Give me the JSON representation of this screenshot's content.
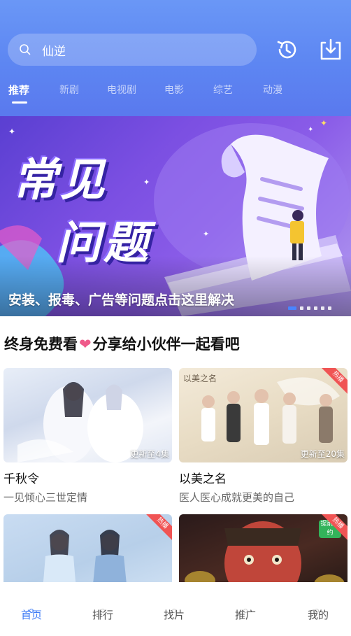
{
  "search": {
    "text": "仙逆"
  },
  "icons": {
    "search": "search-icon",
    "history": "history-icon",
    "download": "download-icon"
  },
  "tabs": [
    {
      "label": "推荐",
      "active": true
    },
    {
      "label": "新剧",
      "active": false
    },
    {
      "label": "电视剧",
      "active": false
    },
    {
      "label": "电影",
      "active": false
    },
    {
      "label": "综艺",
      "active": false
    },
    {
      "label": "动漫",
      "active": false
    }
  ],
  "banner": {
    "title_line1": "常见",
    "title_line2": "问题",
    "caption": "安装、报毒、广告等问题点击这里解决",
    "slide_count": 6,
    "active_slide": 1
  },
  "section": {
    "title_part1": "终身免费看",
    "heart": "❤",
    "title_part2": "分享给小伙伴一起看吧"
  },
  "cards": [
    {
      "name": "千秋令",
      "desc": "一见倾心三世定情",
      "badge": "更新至4集",
      "hot": ""
    },
    {
      "name": "以美之名",
      "desc": "医人医心成就更美的自己",
      "badge": "更新至20集",
      "hot": "热播",
      "poster_title": "以美之名"
    },
    {
      "name": "",
      "desc": "",
      "badge": "",
      "hot": "热播"
    },
    {
      "name": "",
      "desc": "",
      "badge": "",
      "hot": "热播",
      "tag": "提前预约"
    }
  ],
  "bottom_nav": [
    {
      "label": "首页",
      "active": true
    },
    {
      "label": "排行",
      "active": false
    },
    {
      "label": "找片",
      "active": false
    },
    {
      "label": "推广",
      "active": false
    },
    {
      "label": "我的",
      "active": false
    }
  ],
  "colors": {
    "accent": "#3d7bf6",
    "header_top": "#6a97f6",
    "header_bottom": "#5a79ee",
    "heart": "#ef5a8a",
    "hot_badge": "#f05454"
  }
}
